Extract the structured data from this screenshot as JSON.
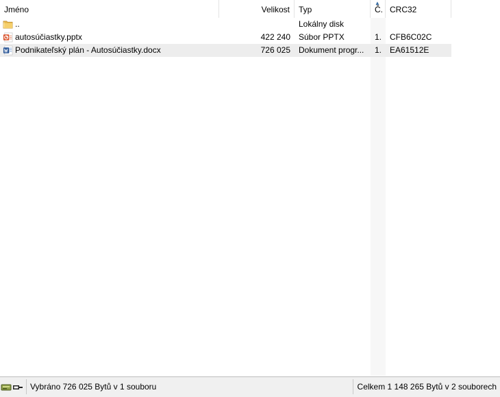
{
  "columns": {
    "name": "Jméno",
    "size": "Velikost",
    "type": "Typ",
    "num": "Č.",
    "crc": "CRC32",
    "sorted_column": "num",
    "sort_icon": "sort-ascending-icon"
  },
  "rows": [
    {
      "icon": "parent-folder-icon",
      "name": "..",
      "size": "",
      "type": "Lokálny disk",
      "num": "",
      "crc": "",
      "selected": false
    },
    {
      "icon": "powerpoint-file-icon",
      "name": "autosúčiastky.pptx",
      "size": "422 240",
      "type": "Súbor PPTX",
      "num": "1.",
      "crc": "CFB6C02C",
      "selected": false
    },
    {
      "icon": "word-document-icon",
      "name": "Podnikateľský plán - Autosúčiastky.docx",
      "size": "726 025",
      "type": "Dokument progr...",
      "num": "1.",
      "crc": "EA61512E",
      "selected": true
    }
  ],
  "status": {
    "drive_icon": "drive-icon",
    "selected_text": "Vybráno 726 025 Bytů v 1 souboru",
    "total_text": "Celkem 1 148 265 Bytů v 2 souborech"
  },
  "colors": {
    "selected_row": "#ededed",
    "sorted_column": "#f7f7f7",
    "statusbar": "#f0f0f0",
    "folder": "#e8b64a",
    "pptx": "#d9532c",
    "docx": "#2b5797"
  }
}
